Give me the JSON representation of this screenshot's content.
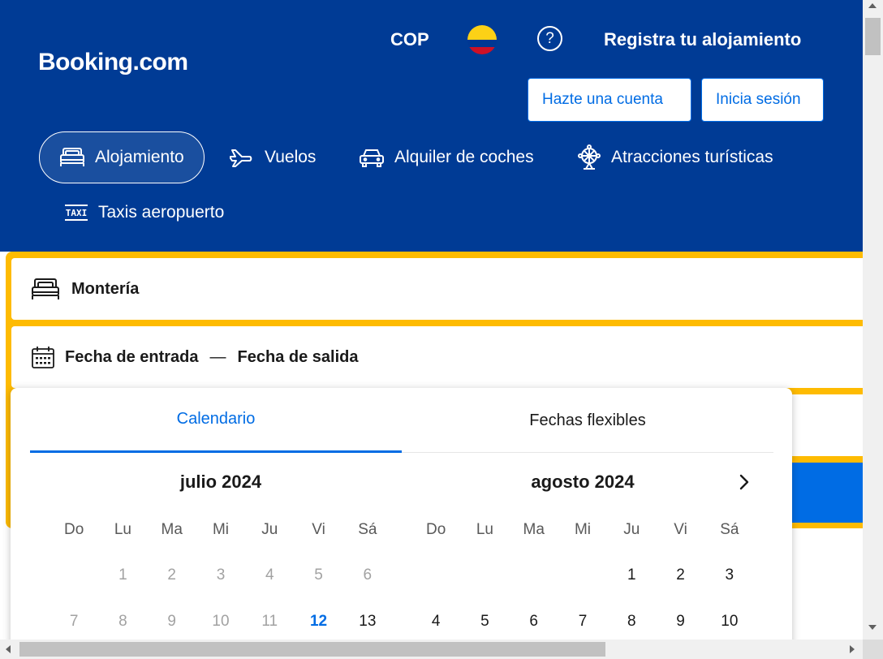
{
  "header": {
    "logo": "Booking.com",
    "currency": "COP",
    "help_symbol": "?",
    "list_property": "Registra tu alojamiento",
    "register_button": "Hazte una cuenta",
    "login_button": "Inicia sesión",
    "colors": {
      "background": "#003b95",
      "accent": "#006ce4"
    }
  },
  "nav": {
    "items": [
      {
        "label": "Alojamiento",
        "icon": "bed-icon",
        "active": true
      },
      {
        "label": "Vuelos",
        "icon": "plane-icon"
      },
      {
        "label": "Alquiler de coches",
        "icon": "car-icon"
      },
      {
        "label": "Atracciones turísticas",
        "icon": "ferris-wheel-icon"
      },
      {
        "label": "Taxis aeropuerto",
        "icon": "taxi-icon"
      }
    ]
  },
  "search": {
    "destination": "Montería",
    "checkin_label": "Fecha de entrada",
    "separator": "—",
    "checkout_label": "Fecha de salida",
    "highlight_color": "#febb02"
  },
  "calendar": {
    "tabs": [
      {
        "label": "Calendario",
        "active": true
      },
      {
        "label": "Fechas flexibles",
        "active": false
      }
    ],
    "weekdays": [
      "Do",
      "Lu",
      "Ma",
      "Mi",
      "Ju",
      "Vi",
      "Sá"
    ],
    "months": [
      {
        "title": "julio 2024",
        "weeks": [
          [
            "",
            "1",
            "2",
            "3",
            "4",
            "5",
            "6"
          ],
          [
            "7",
            "8",
            "9",
            "10",
            "11",
            "12",
            "13"
          ]
        ]
      },
      {
        "title": "agosto 2024",
        "weeks": [
          [
            "",
            "",
            "",
            "",
            "1",
            "2",
            "3"
          ],
          [
            "4",
            "5",
            "6",
            "7",
            "8",
            "9",
            "10"
          ]
        ]
      }
    ]
  }
}
